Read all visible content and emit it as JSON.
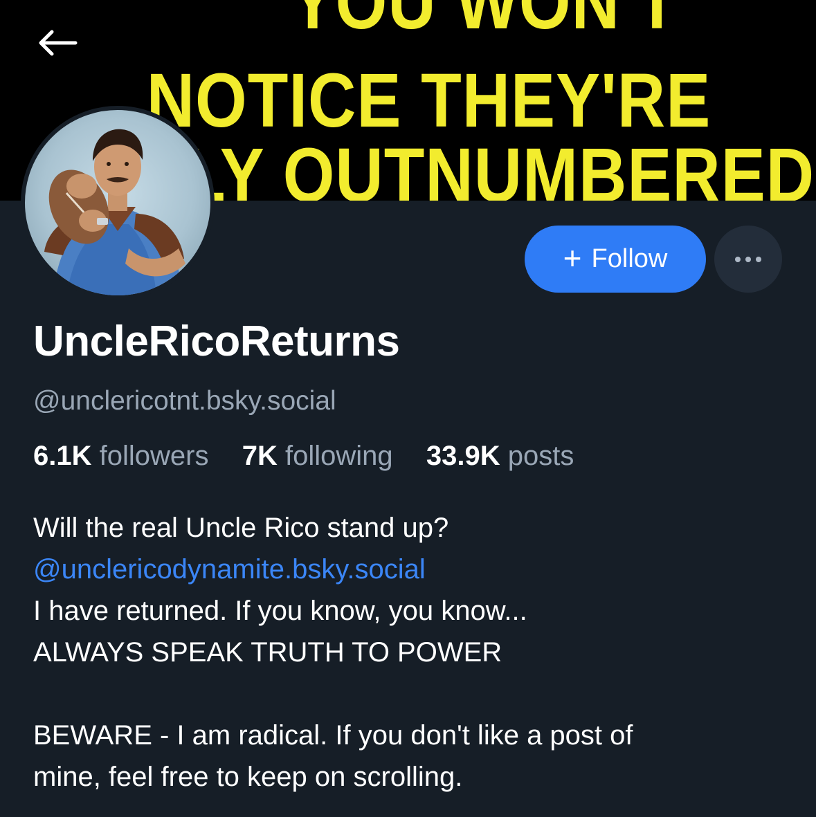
{
  "banner": {
    "line1": "YOU WON'T",
    "line2": "NOTICE THEY'RE",
    "line3": "SLY OUTNUMBERED",
    "text_color": "#f2ec2e",
    "background": "#000000"
  },
  "nav": {
    "back_icon": "arrow-left-icon"
  },
  "profile": {
    "display_name": "UncleRicoReturns",
    "handle": "@unclericotnt.bsky.social",
    "avatar_icon": "avatar-photo"
  },
  "actions": {
    "follow_plus": "+",
    "follow_label": "Follow",
    "more_icon": "ellipsis-icon",
    "follow_color": "#2f7cf6"
  },
  "stats": {
    "followers_count": "6.1K",
    "followers_label": "followers",
    "following_count": "7K",
    "following_label": "following",
    "posts_count": "33.9K",
    "posts_label": "posts"
  },
  "bio": {
    "line1": "Will the real Uncle Rico stand up?",
    "mention": "@unclericodynamite.bsky.social",
    "line3": "I have returned. If you know, you know...",
    "line4": "ALWAYS SPEAK TRUTH TO POWER",
    "line5": "BEWARE - I am radical. If you don't like a post of",
    "line6": "mine, feel free to keep on scrolling."
  }
}
